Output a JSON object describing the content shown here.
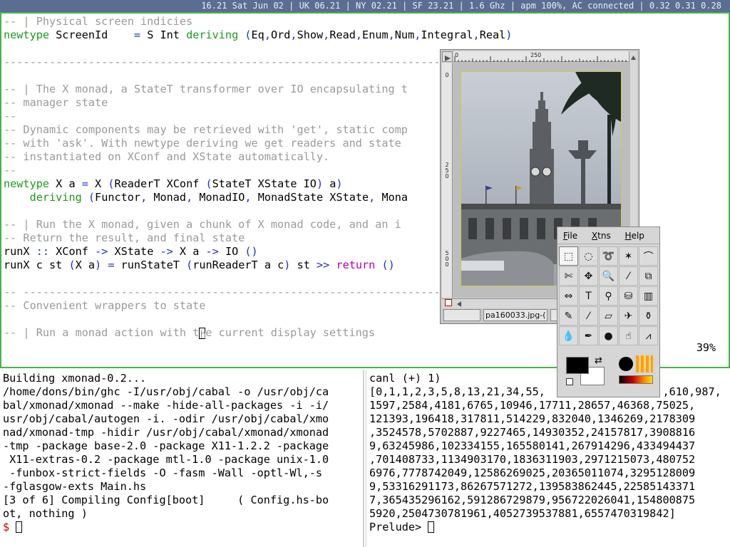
{
  "statusbar": {
    "text": "16.21 Sat Jun 02 | UK 06.21 | NY 02.21 | SF 23.21 | 1.6 Ghz | apm 100%, AC connected | 0.32 0.31 0.28"
  },
  "editor": {
    "lines": [
      [
        {
          "t": "-- | Physical screen indicies",
          "c": "comment"
        }
      ],
      [
        {
          "t": "newtype",
          "c": "kw"
        },
        {
          "t": " ScreenId    ",
          "c": "plain"
        },
        {
          "t": "=",
          "c": "op"
        },
        {
          "t": " S Int ",
          "c": "plain"
        },
        {
          "t": "deriving",
          "c": "kw"
        },
        {
          "t": " ",
          "c": "plain"
        },
        {
          "t": "(",
          "c": "op"
        },
        {
          "t": "Eq",
          "c": "plain"
        },
        {
          "t": ",",
          "c": "op"
        },
        {
          "t": "Ord",
          "c": "plain"
        },
        {
          "t": ",",
          "c": "op"
        },
        {
          "t": "Show",
          "c": "plain"
        },
        {
          "t": ",",
          "c": "op"
        },
        {
          "t": "Read",
          "c": "plain"
        },
        {
          "t": ",",
          "c": "op"
        },
        {
          "t": "Enum",
          "c": "plain"
        },
        {
          "t": ",",
          "c": "op"
        },
        {
          "t": "Num",
          "c": "plain"
        },
        {
          "t": ",",
          "c": "op"
        },
        {
          "t": "Integral",
          "c": "plain"
        },
        {
          "t": ",",
          "c": "op"
        },
        {
          "t": "Real",
          "c": "plain"
        },
        {
          "t": ")",
          "c": "op"
        }
      ],
      [
        {
          "t": "",
          "c": "plain"
        }
      ],
      [
        {
          "t": "------------------------------------------------------------------------",
          "c": "comment"
        }
      ],
      [
        {
          "t": "",
          "c": "plain"
        }
      ],
      [
        {
          "t": "-- | The X monad, a StateT transformer over IO encapsulating t",
          "c": "comment"
        }
      ],
      [
        {
          "t": "-- manager state",
          "c": "comment"
        }
      ],
      [
        {
          "t": "--",
          "c": "comment"
        }
      ],
      [
        {
          "t": "-- Dynamic components may be retrieved with 'get', static comp",
          "c": "comment"
        }
      ],
      [
        {
          "t": "-- with 'ask'. With newtype deriving we get readers and state",
          "c": "comment"
        }
      ],
      [
        {
          "t": "-- instantiated on XConf and XState automatically.",
          "c": "comment"
        }
      ],
      [
        {
          "t": "--",
          "c": "comment"
        }
      ],
      [
        {
          "t": "newtype",
          "c": "kw"
        },
        {
          "t": " X a ",
          "c": "plain"
        },
        {
          "t": "=",
          "c": "op"
        },
        {
          "t": " X ",
          "c": "plain"
        },
        {
          "t": "(",
          "c": "op"
        },
        {
          "t": "ReaderT XConf ",
          "c": "plain"
        },
        {
          "t": "(",
          "c": "op"
        },
        {
          "t": "StateT XState IO",
          "c": "plain"
        },
        {
          "t": ")",
          "c": "op"
        },
        {
          "t": " a",
          "c": "plain"
        },
        {
          "t": ")",
          "c": "op"
        }
      ],
      [
        {
          "t": "    ",
          "c": "plain"
        },
        {
          "t": "deriving",
          "c": "kw"
        },
        {
          "t": " ",
          "c": "plain"
        },
        {
          "t": "(",
          "c": "op"
        },
        {
          "t": "Functor",
          "c": "plain"
        },
        {
          "t": ",",
          "c": "op"
        },
        {
          "t": " Monad",
          "c": "plain"
        },
        {
          "t": ",",
          "c": "op"
        },
        {
          "t": " MonadIO",
          "c": "plain"
        },
        {
          "t": ",",
          "c": "op"
        },
        {
          "t": " MonadState XState",
          "c": "plain"
        },
        {
          "t": ",",
          "c": "op"
        },
        {
          "t": " Mona",
          "c": "plain"
        }
      ],
      [
        {
          "t": "",
          "c": "plain"
        }
      ],
      [
        {
          "t": "-- | Run the X monad, given a chunk of X monad code, and an i",
          "c": "comment"
        }
      ],
      [
        {
          "t": "-- Return the result, and final state",
          "c": "comment"
        }
      ],
      [
        {
          "t": "runX ",
          "c": "plain"
        },
        {
          "t": "::",
          "c": "op"
        },
        {
          "t": " XConf ",
          "c": "plain"
        },
        {
          "t": "->",
          "c": "op"
        },
        {
          "t": " XState ",
          "c": "plain"
        },
        {
          "t": "->",
          "c": "op"
        },
        {
          "t": " X a ",
          "c": "plain"
        },
        {
          "t": "->",
          "c": "op"
        },
        {
          "t": " IO ",
          "c": "plain"
        },
        {
          "t": "()",
          "c": "op"
        }
      ],
      [
        {
          "t": "runX c st ",
          "c": "plain"
        },
        {
          "t": "(",
          "c": "op"
        },
        {
          "t": "X a",
          "c": "plain"
        },
        {
          "t": ")",
          "c": "op"
        },
        {
          "t": " ",
          "c": "plain"
        },
        {
          "t": "=",
          "c": "op"
        },
        {
          "t": " runStateT ",
          "c": "plain"
        },
        {
          "t": "(",
          "c": "op"
        },
        {
          "t": "runReaderT a c",
          "c": "plain"
        },
        {
          "t": ")",
          "c": "op"
        },
        {
          "t": " st ",
          "c": "plain"
        },
        {
          "t": ">>",
          "c": "op"
        },
        {
          "t": " ",
          "c": "plain"
        },
        {
          "t": "return",
          "c": "ret"
        },
        {
          "t": " ",
          "c": "plain"
        },
        {
          "t": "()",
          "c": "op"
        }
      ],
      [
        {
          "t": "",
          "c": "plain"
        }
      ],
      [
        {
          "t": "-- ---------------------------------------------------------------------",
          "c": "comment"
        }
      ],
      [
        {
          "t": "-- Convenient wrappers to state",
          "c": "comment"
        }
      ],
      [
        {
          "t": "",
          "c": "plain"
        }
      ],
      [
        {
          "t": "-- | Run a monad action with t",
          "c": "comment"
        },
        {
          "t": "h",
          "c": "cursor"
        },
        {
          "t": "e current display settings",
          "c": "comment"
        }
      ]
    ],
    "percent": "39%"
  },
  "terminal_left": {
    "lines": [
      "Building xmonad-0.2...",
      "/home/dons/bin/ghc -I/usr/obj/cabal -o /usr/obj/ca",
      "bal/xmonad/xmonad --make -hide-all-packages -i -i/",
      "usr/obj/cabal/autogen -i. -odir /usr/obj/cabal/xmo",
      "nad/xmonad-tmp -hidir /usr/obj/cabal/xmonad/xmonad",
      "-tmp -package base-2.0 -package X11-1.2.2 -package",
      " X11-extras-0.2 -package mtl-1.0 -package unix-1.0",
      " -funbox-strict-fields -O -fasm -Wall -optl-Wl,-s",
      "-fglasgow-exts Main.hs",
      "[3 of 6] Compiling Config[boot]     ( Config.hs-bo",
      "ot, nothing )"
    ],
    "prompt": "$"
  },
  "terminal_right": {
    "lines": [
      "canl (+) 1)",
      "[0,1,1,2,3,5,8,13,21,34,55,                  ,610,987,",
      "1597,2584,4181,6765,10946,17711,28657,46368,75025,",
      "121393,196418,317811,514229,832040,1346269,2178309",
      ",3524578,5702887,9227465,14930352,24157817,3908816",
      "9,63245986,102334155,165580141,267914296,433494437",
      ",701408733,1134903170,1836311903,2971215073,480752",
      "6976,7778742049,12586269025,20365011074,3295128009",
      "9,53316291173,86267571272,139583862445,22585143371",
      "7,365435296162,591286729879,956722026041,154800875",
      "5920,2504730781961,4052739537881,6557470319842]"
    ],
    "prompt": "Prelude>"
  },
  "gimp_image": {
    "ruler_h": [
      "0",
      "250"
    ],
    "ruler_v": [
      "0",
      "250",
      "500"
    ],
    "filename": "pa160033.jpg-("
  },
  "gimp_toolbox": {
    "menu": [
      {
        "underline": "F",
        "rest": "ile"
      },
      {
        "underline": "X",
        "rest": "tns"
      },
      {
        "underline": "H",
        "rest": "elp"
      }
    ],
    "tools": [
      {
        "name": "rect-select-icon",
        "glyph": "⬚",
        "active": true
      },
      {
        "name": "ellipse-select-icon",
        "glyph": "◌"
      },
      {
        "name": "lasso-icon",
        "glyph": "➰"
      },
      {
        "name": "magic-wand-icon",
        "glyph": "✶"
      },
      {
        "name": "bezier-select-icon",
        "glyph": "⌒"
      },
      {
        "name": "scissors-icon",
        "glyph": "✄"
      },
      {
        "name": "move-icon",
        "glyph": "✥"
      },
      {
        "name": "magnify-icon",
        "glyph": "🔍"
      },
      {
        "name": "crop-icon",
        "glyph": "⁄"
      },
      {
        "name": "transform-icon",
        "glyph": "⧉"
      },
      {
        "name": "flip-icon",
        "glyph": "⇔"
      },
      {
        "name": "text-icon",
        "glyph": "T"
      },
      {
        "name": "color-picker-icon",
        "glyph": "⚲"
      },
      {
        "name": "bucket-fill-icon",
        "glyph": "⛁"
      },
      {
        "name": "blend-icon",
        "glyph": "▥"
      },
      {
        "name": "pencil-icon",
        "glyph": "✎"
      },
      {
        "name": "paintbrush-icon",
        "glyph": "⁄"
      },
      {
        "name": "eraser-icon",
        "glyph": "▱"
      },
      {
        "name": "airbrush-icon",
        "glyph": "✈"
      },
      {
        "name": "clone-icon",
        "glyph": "⚱"
      },
      {
        "name": "convolve-icon",
        "glyph": "💧"
      },
      {
        "name": "ink-icon",
        "glyph": "✒"
      },
      {
        "name": "dodge-burn-icon",
        "glyph": "●"
      },
      {
        "name": "smudge-icon",
        "glyph": "☝"
      },
      {
        "name": "measure-icon",
        "glyph": "⩘"
      }
    ],
    "fg_color": "#000000",
    "bg_color": "#ffffff"
  }
}
